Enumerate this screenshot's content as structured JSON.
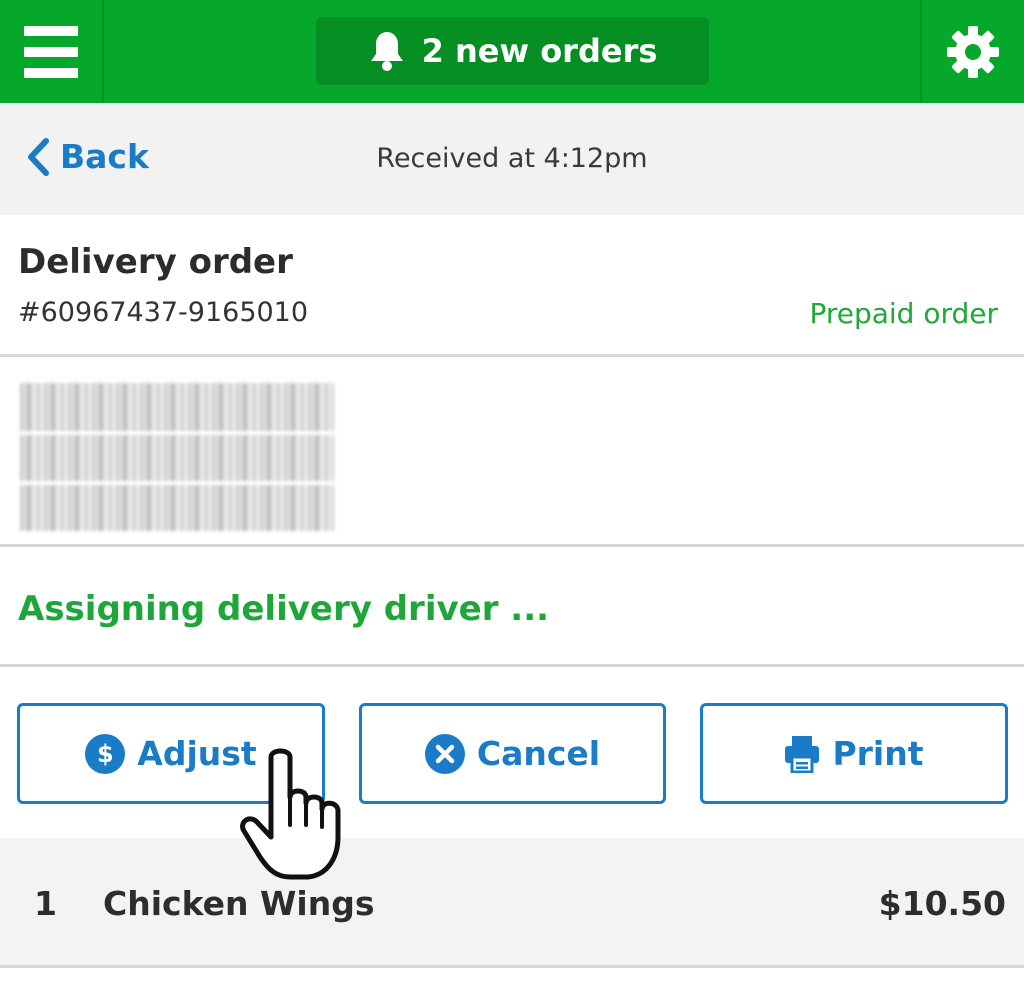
{
  "header": {
    "menu_icon": "hamburger-menu-icon",
    "notification_icon": "bell-icon",
    "notification_label": "2 new orders",
    "settings_icon": "gear-icon",
    "brand_color": "#05a82b"
  },
  "subheader": {
    "back_label": "Back",
    "received_label": "Received at 4:12pm"
  },
  "order": {
    "title": "Delivery order",
    "number": "#60967437-9165010",
    "payment_status": "Prepaid order"
  },
  "status": {
    "text": "Assigning delivery driver ..."
  },
  "actions": {
    "adjust_label": "Adjust",
    "adjust_icon": "dollar-circle-icon",
    "cancel_label": "Cancel",
    "cancel_icon": "x-circle-icon",
    "print_label": "Print",
    "print_icon": "printer-icon",
    "accent_color": "#1a7bc7"
  },
  "items": [
    {
      "qty": "1",
      "name": "Chicken Wings",
      "price": "$10.50"
    }
  ]
}
